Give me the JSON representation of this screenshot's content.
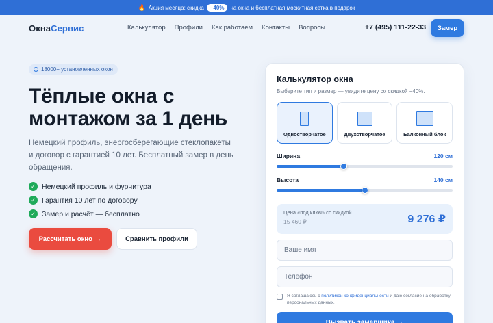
{
  "promo": {
    "icon": "fire-icon",
    "prefix": "Акция месяца: скидка",
    "discount": "−40%",
    "suffix": "на окна и бесплатная москитная сетка в подарок"
  },
  "header": {
    "logo_part1": "Окна",
    "logo_part2": "Сервис",
    "nav": [
      "Калькулятор",
      "Профили",
      "Как работаем",
      "Контакты",
      "Вопросы"
    ],
    "phone": "+7 (495) 111-22-33",
    "cta": "Замер"
  },
  "hero": {
    "badge": "18000+ установленных окон",
    "title_line1": "Тёплые окна с",
    "title_line2": "монтажом за 1 день",
    "lead": "Немецкий профиль, энергосберегающие стеклопакеты и договор с гарантией 10 лет. Бесплатный замер в день обращения.",
    "checks": [
      "Немецкий профиль и фурнитура",
      "Гарантия 10 лет по договору",
      "Замер и расчёт — бесплатно"
    ],
    "primary_cta": "Рассчитать окно",
    "primary_arrow": "→",
    "secondary_cta": "Сравнить профили"
  },
  "calculator": {
    "title": "Калькулятор окна",
    "subtitle": "Выберите тип и размер — увидите цену со скидкой −40%.",
    "types": [
      {
        "label": "Одностворчатое",
        "active": true
      },
      {
        "label": "Двухстворчатое",
        "active": false
      },
      {
        "label": "Балконный блок",
        "active": false
      }
    ],
    "width": {
      "label": "Ширина",
      "value": "120 см",
      "fraction": 0.38
    },
    "height": {
      "label": "Высота",
      "value": "140 см",
      "fraction": 0.5
    },
    "price_label": "Цена «под ключ» со скидкой",
    "price_old": "15 460 ₽",
    "price_new": "9 276 ₽",
    "name_placeholder": "Ваше имя",
    "phone_placeholder": "Телефон",
    "consent_prefix": "Я соглашаюсь с",
    "consent_link": "политикой конфиденциальности",
    "consent_suffix": "и даю согласие на обработку персональных данных.",
    "submit": "Вызвать замерщика →"
  },
  "colors": {
    "accent": "#2f7ae0",
    "cta_red": "#ea4b3f",
    "success": "#1faa5a"
  }
}
